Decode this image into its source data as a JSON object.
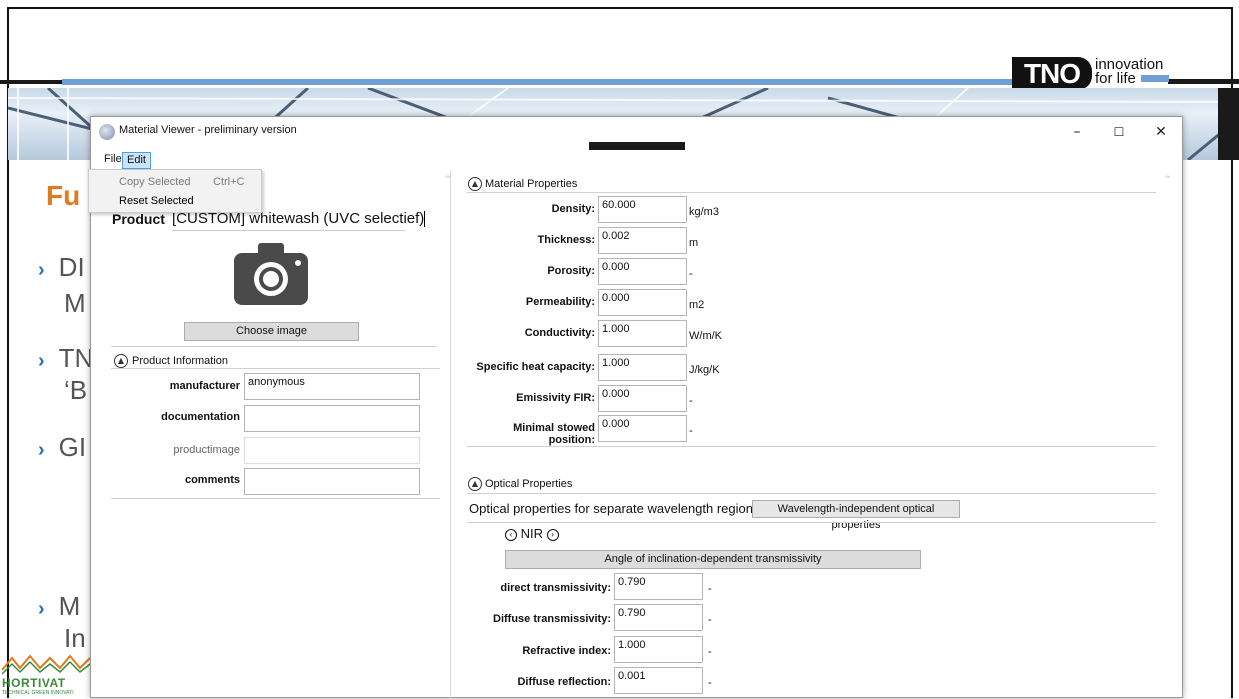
{
  "slide": {
    "title": "Fu",
    "bullets": [
      {
        "line1": "DI",
        "line2": "M"
      },
      {
        "line1": "TN",
        "line2": "‘B"
      },
      {
        "line1": "GI",
        "line2": ""
      },
      {
        "line1": "M",
        "line2": "In"
      }
    ],
    "logo": {
      "brand": "TNO",
      "tagline_1": "innovation",
      "tagline_2": "for life"
    },
    "partner_logo": {
      "name": "HORTIVAT",
      "sub": "TECHNICAL GREEN INNOVATI"
    }
  },
  "window": {
    "title": "Material Viewer - preliminary version",
    "controls": {
      "minimize": "–",
      "maximize": "☐",
      "close": "✕"
    },
    "menu": {
      "file": "File",
      "edit": "Edit",
      "edit_items": [
        {
          "label": "Copy Selected",
          "shortcut": "Ctrl+C",
          "disabled": true
        },
        {
          "label": "Reset Selected",
          "shortcut": "",
          "disabled": false
        }
      ]
    },
    "product": {
      "label": "Product",
      "value": "[CUSTOM] whitewash (UVC selectief)",
      "camera_icon": "camera-icon",
      "choose_image": "Choose image"
    },
    "product_info": {
      "heading": "Product Information",
      "fields": [
        {
          "label": "manufacturer",
          "value": "anonymous"
        },
        {
          "label": "documentation",
          "value": ""
        },
        {
          "label": "productimage",
          "value": ""
        },
        {
          "label": "comments",
          "value": ""
        }
      ]
    },
    "material_properties": {
      "heading": "Material Properties",
      "rows": [
        {
          "label": "Density:",
          "value": "60.000",
          "unit": "kg/m3"
        },
        {
          "label": "Thickness:",
          "value": "0.002",
          "unit": "m"
        },
        {
          "label": "Porosity:",
          "value": "0.000",
          "unit": "-"
        },
        {
          "label": "Permeability:",
          "value": "0.000",
          "unit": "m2"
        },
        {
          "label": "Conductivity:",
          "value": "1.000",
          "unit": "W/m/K"
        },
        {
          "label": "Specific heat capacity:",
          "value": "1.000",
          "unit": "J/kg/K"
        },
        {
          "label": "Emissivity FIR:",
          "value": "0.000",
          "unit": "-"
        },
        {
          "label": "Minimal stowed position:",
          "value": "0.000",
          "unit": "-"
        }
      ]
    },
    "optical_properties": {
      "heading": "Optical Properties",
      "tab_active": "Optical properties for separate wavelength regions",
      "tab_other": "Wavelength-independent optical properties",
      "region": "NIR",
      "angle_button": "Angle of inclination-dependent transmissivity",
      "rows": [
        {
          "label": "direct transmissivity:",
          "value": "0.790",
          "unit": "-"
        },
        {
          "label": "Diffuse transmissivity:",
          "value": "0.790",
          "unit": "-"
        },
        {
          "label": "Refractive index:",
          "value": "1.000",
          "unit": "-"
        },
        {
          "label": "Diffuse reflection:",
          "value": "0.001",
          "unit": "-"
        }
      ]
    }
  }
}
